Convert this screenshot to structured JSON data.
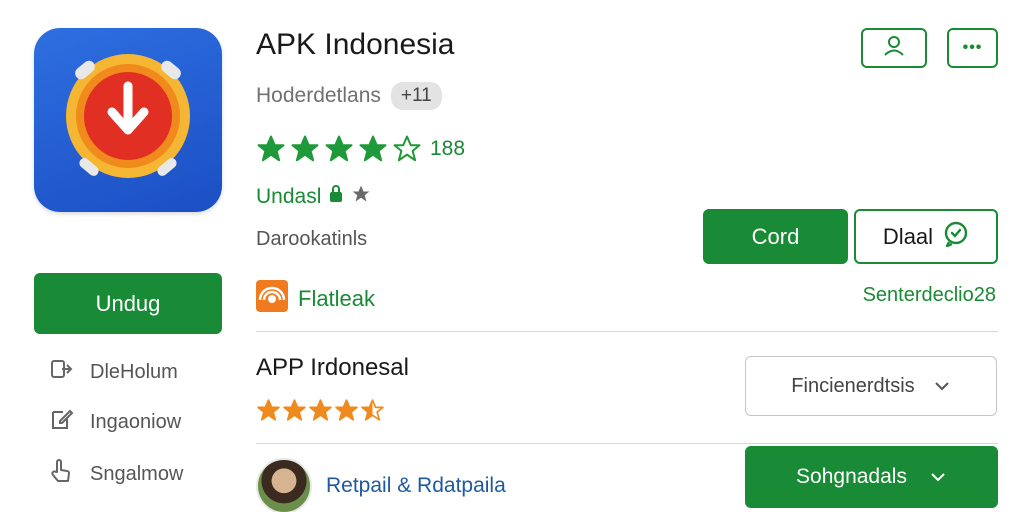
{
  "app": {
    "title": "APK Indonesia",
    "developer": "Hoderdetlans",
    "badge": "+11",
    "rating_count": "188",
    "rating_stars": 4,
    "status_label": "Undasl",
    "description": "Darookatinls",
    "source_label": "Flatleak",
    "sent_label": "Senterdeclio28"
  },
  "sidebar": {
    "primary_label": "Undug",
    "items": [
      {
        "label": "DleHolum",
        "icon": "share-icon"
      },
      {
        "label": "Ingaoniow",
        "icon": "edit-icon"
      },
      {
        "label": "Sngalmow",
        "icon": "hand-pointer-icon"
      }
    ]
  },
  "header_actions": [
    {
      "icon": "person-icon"
    },
    {
      "icon": "more-icon",
      "label": "•••"
    }
  ],
  "actions": {
    "primary_label": "Cord",
    "secondary_label": "Dlaal"
  },
  "related": {
    "title": "APP Irdonesal",
    "rating_stars": 4.5,
    "select_label": "Fincienerdtsis",
    "author": "Retpail & Rdatpaila",
    "dropdown_label": "Sohgnadals"
  },
  "colors": {
    "accent": "#198a36",
    "star_green": "#1f9a3a",
    "star_orange": "#f08a1c",
    "icon_blue": "#1b4fc4",
    "link_blue": "#1f5aa0"
  }
}
